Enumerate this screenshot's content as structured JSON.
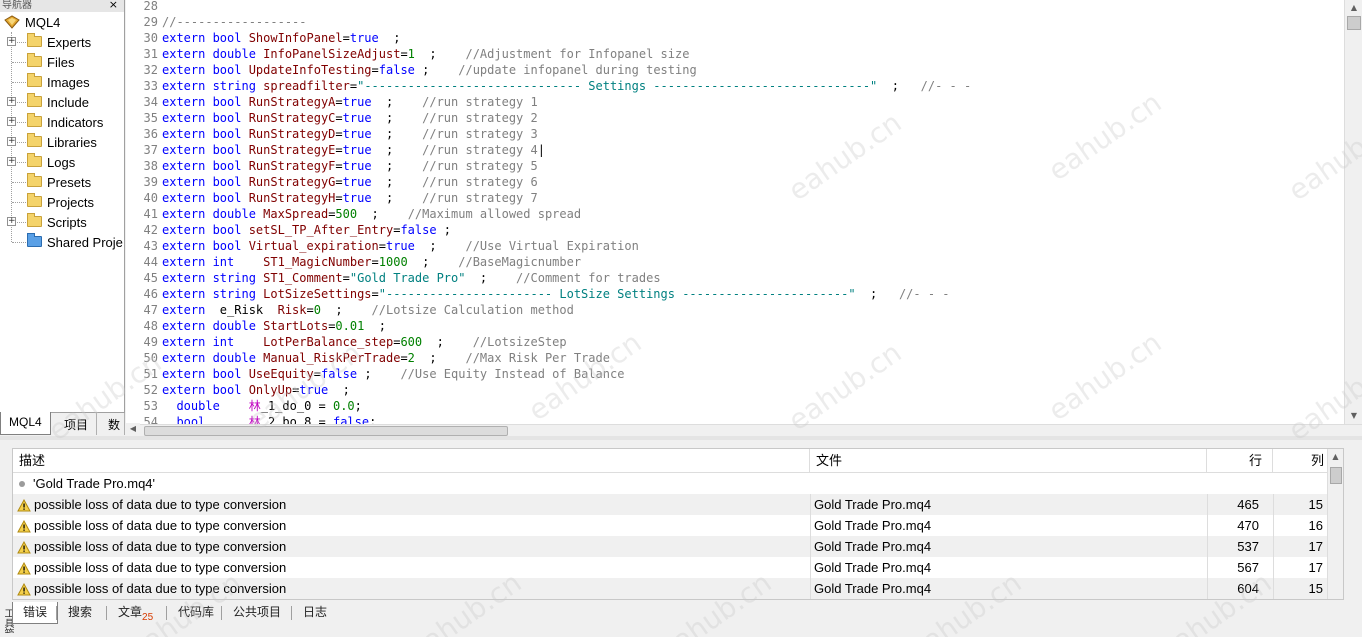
{
  "navigator": {
    "title": "导航器",
    "close_label": "×",
    "root_label": "MQL4",
    "items": [
      {
        "label": "Experts",
        "expandable": true
      },
      {
        "label": "Files",
        "expandable": false
      },
      {
        "label": "Images",
        "expandable": false
      },
      {
        "label": "Include",
        "expandable": true
      },
      {
        "label": "Indicators",
        "expandable": true
      },
      {
        "label": "Libraries",
        "expandable": true
      },
      {
        "label": "Logs",
        "expandable": true
      },
      {
        "label": "Presets",
        "expandable": false
      },
      {
        "label": "Projects",
        "expandable": false
      },
      {
        "label": "Scripts",
        "expandable": true
      },
      {
        "label": "Shared Proje",
        "expandable": false,
        "icon": "blue"
      }
    ],
    "tabs": [
      {
        "label": "MQL4",
        "active": true
      },
      {
        "label": "项目",
        "active": false
      },
      {
        "label": "数",
        "active": false
      }
    ]
  },
  "editor": {
    "lines": [
      {
        "n": "28",
        "t": []
      },
      {
        "n": "29",
        "t": [
          [
            "c",
            "//------------------"
          ]
        ]
      },
      {
        "n": "30",
        "t": [
          [
            "k",
            "extern "
          ],
          [
            "t",
            "bool "
          ],
          [
            "i",
            "ShowInfoPanel"
          ],
          [
            "p",
            "="
          ],
          [
            "k",
            "true"
          ],
          [
            "p",
            "  ;"
          ]
        ]
      },
      {
        "n": "31",
        "t": [
          [
            "k",
            "extern "
          ],
          [
            "t",
            "double "
          ],
          [
            "i",
            "InfoPanelSizeAdjust"
          ],
          [
            "p",
            "="
          ],
          [
            "n",
            "1"
          ],
          [
            "p",
            "  ;    "
          ],
          [
            "c",
            "//Adjustment for Infopanel size"
          ]
        ]
      },
      {
        "n": "32",
        "t": [
          [
            "k",
            "extern "
          ],
          [
            "t",
            "bool "
          ],
          [
            "i",
            "UpdateInfoTesting"
          ],
          [
            "p",
            "="
          ],
          [
            "k",
            "false"
          ],
          [
            "p",
            " ;    "
          ],
          [
            "c",
            "//update infopanel during testing"
          ]
        ]
      },
      {
        "n": "33",
        "t": [
          [
            "k",
            "extern "
          ],
          [
            "t",
            "string "
          ],
          [
            "i",
            "spreadfilter"
          ],
          [
            "p",
            "="
          ],
          [
            "s",
            "\"------------------------------ Settings ------------------------------\""
          ],
          [
            "p",
            "  ;   "
          ],
          [
            "c",
            "//- - -"
          ]
        ]
      },
      {
        "n": "34",
        "t": [
          [
            "k",
            "extern "
          ],
          [
            "t",
            "bool "
          ],
          [
            "i",
            "RunStrategyA"
          ],
          [
            "p",
            "="
          ],
          [
            "k",
            "true"
          ],
          [
            "p",
            "  ;    "
          ],
          [
            "c",
            "//run strategy 1"
          ]
        ]
      },
      {
        "n": "35",
        "t": [
          [
            "k",
            "extern "
          ],
          [
            "t",
            "bool "
          ],
          [
            "i",
            "RunStrategyC"
          ],
          [
            "p",
            "="
          ],
          [
            "k",
            "true"
          ],
          [
            "p",
            "  ;    "
          ],
          [
            "c",
            "//run strategy 2"
          ]
        ]
      },
      {
        "n": "36",
        "t": [
          [
            "k",
            "extern "
          ],
          [
            "t",
            "bool "
          ],
          [
            "i",
            "RunStrategyD"
          ],
          [
            "p",
            "="
          ],
          [
            "k",
            "true"
          ],
          [
            "p",
            "  ;    "
          ],
          [
            "c",
            "//run strategy 3"
          ]
        ]
      },
      {
        "n": "37",
        "t": [
          [
            "k",
            "extern "
          ],
          [
            "t",
            "bool "
          ],
          [
            "i",
            "RunStrategyE"
          ],
          [
            "p",
            "="
          ],
          [
            "k",
            "true"
          ],
          [
            "p",
            "  ;    "
          ],
          [
            "c",
            "//run strategy 4"
          ],
          [
            "x",
            "|"
          ]
        ]
      },
      {
        "n": "38",
        "t": [
          [
            "k",
            "extern "
          ],
          [
            "t",
            "bool "
          ],
          [
            "i",
            "RunStrategyF"
          ],
          [
            "p",
            "="
          ],
          [
            "k",
            "true"
          ],
          [
            "p",
            "  ;    "
          ],
          [
            "c",
            "//run strategy 5"
          ]
        ]
      },
      {
        "n": "39",
        "t": [
          [
            "k",
            "extern "
          ],
          [
            "t",
            "bool "
          ],
          [
            "i",
            "RunStrategyG"
          ],
          [
            "p",
            "="
          ],
          [
            "k",
            "true"
          ],
          [
            "p",
            "  ;    "
          ],
          [
            "c",
            "//run strategy 6"
          ]
        ]
      },
      {
        "n": "40",
        "t": [
          [
            "k",
            "extern "
          ],
          [
            "t",
            "bool "
          ],
          [
            "i",
            "RunStrategyH"
          ],
          [
            "p",
            "="
          ],
          [
            "k",
            "true"
          ],
          [
            "p",
            "  ;    "
          ],
          [
            "c",
            "//run strategy 7"
          ]
        ]
      },
      {
        "n": "41",
        "t": [
          [
            "k",
            "extern "
          ],
          [
            "t",
            "double "
          ],
          [
            "i",
            "MaxSpread"
          ],
          [
            "p",
            "="
          ],
          [
            "n",
            "500"
          ],
          [
            "p",
            "  ;    "
          ],
          [
            "c",
            "//Maximum allowed spread"
          ]
        ]
      },
      {
        "n": "42",
        "t": [
          [
            "k",
            "extern "
          ],
          [
            "t",
            "bool "
          ],
          [
            "i",
            "setSL_TP_After_Entry"
          ],
          [
            "p",
            "="
          ],
          [
            "k",
            "false"
          ],
          [
            "p",
            " ;"
          ]
        ]
      },
      {
        "n": "43",
        "t": [
          [
            "k",
            "extern "
          ],
          [
            "t",
            "bool "
          ],
          [
            "i",
            "Virtual_expiration"
          ],
          [
            "p",
            "="
          ],
          [
            "k",
            "true"
          ],
          [
            "p",
            "  ;    "
          ],
          [
            "c",
            "//Use Virtual Expiration"
          ]
        ]
      },
      {
        "n": "44",
        "t": [
          [
            "k",
            "extern "
          ],
          [
            "t",
            "int    "
          ],
          [
            "i",
            "ST1_MagicNumber"
          ],
          [
            "p",
            "="
          ],
          [
            "n",
            "1000"
          ],
          [
            "p",
            "  ;    "
          ],
          [
            "c",
            "//BaseMagicnumber"
          ]
        ]
      },
      {
        "n": "45",
        "t": [
          [
            "k",
            "extern "
          ],
          [
            "t",
            "string "
          ],
          [
            "i",
            "ST1_Comment"
          ],
          [
            "p",
            "="
          ],
          [
            "s",
            "\"Gold Trade Pro\""
          ],
          [
            "p",
            "  ;    "
          ],
          [
            "c",
            "//Comment for trades"
          ]
        ]
      },
      {
        "n": "46",
        "t": [
          [
            "k",
            "extern "
          ],
          [
            "t",
            "string "
          ],
          [
            "i",
            "LotSizeSettings"
          ],
          [
            "p",
            "="
          ],
          [
            "s",
            "\"----------------------- LotSize Settings -----------------------\""
          ],
          [
            "p",
            "  ;   "
          ],
          [
            "c",
            "//- - -"
          ]
        ]
      },
      {
        "n": "47",
        "t": [
          [
            "k",
            "extern  "
          ],
          [
            "p",
            "e_Risk  "
          ],
          [
            "i",
            "Risk"
          ],
          [
            "p",
            "="
          ],
          [
            "n",
            "0"
          ],
          [
            "p",
            "  ;    "
          ],
          [
            "c",
            "//Lotsize Calculation method"
          ]
        ]
      },
      {
        "n": "48",
        "t": [
          [
            "k",
            "extern "
          ],
          [
            "t",
            "double "
          ],
          [
            "i",
            "StartLots"
          ],
          [
            "p",
            "="
          ],
          [
            "n",
            "0.01"
          ],
          [
            "p",
            "  ;"
          ]
        ]
      },
      {
        "n": "49",
        "t": [
          [
            "k",
            "extern "
          ],
          [
            "t",
            "int    "
          ],
          [
            "i",
            "LotPerBalance_step"
          ],
          [
            "p",
            "="
          ],
          [
            "n",
            "600"
          ],
          [
            "p",
            "  ;    "
          ],
          [
            "c",
            "//LotsizeStep"
          ]
        ]
      },
      {
        "n": "50",
        "t": [
          [
            "k",
            "extern "
          ],
          [
            "t",
            "double "
          ],
          [
            "i",
            "Manual_RiskPerTrade"
          ],
          [
            "p",
            "="
          ],
          [
            "n",
            "2"
          ],
          [
            "p",
            "  ;    "
          ],
          [
            "c",
            "//Max Risk Per Trade"
          ]
        ]
      },
      {
        "n": "51",
        "t": [
          [
            "k",
            "extern "
          ],
          [
            "t",
            "bool "
          ],
          [
            "i",
            "UseEquity"
          ],
          [
            "p",
            "="
          ],
          [
            "k",
            "false"
          ],
          [
            "p",
            " ;    "
          ],
          [
            "c",
            "//Use Equity Instead of Balance"
          ]
        ]
      },
      {
        "n": "52",
        "t": [
          [
            "k",
            "extern "
          ],
          [
            "t",
            "bool "
          ],
          [
            "i",
            "OnlyUp"
          ],
          [
            "p",
            "="
          ],
          [
            "k",
            "true"
          ],
          [
            "p",
            "  ;"
          ]
        ]
      },
      {
        "n": "53",
        "t": [
          [
            "p",
            "  "
          ],
          [
            "t",
            "double    "
          ],
          [
            "i",
            "林"
          ],
          [
            "p",
            "_1_do_0 = "
          ],
          [
            "n",
            "0.0"
          ],
          [
            "p",
            ";"
          ]
        ]
      },
      {
        "n": "54",
        "t": [
          [
            "p",
            "  "
          ],
          [
            "t",
            "bool      "
          ],
          [
            "i",
            "林"
          ],
          [
            "p",
            "_2_bo_8 = "
          ],
          [
            "k",
            "false"
          ],
          [
            "p",
            ";"
          ]
        ]
      }
    ]
  },
  "errors": {
    "headers": {
      "desc": "描述",
      "file": "文件",
      "row": "行",
      "col": "列"
    },
    "title_row": "'Gold Trade Pro.mq4'",
    "rows": [
      {
        "desc": "possible loss of data due to type conversion",
        "file": "Gold Trade Pro.mq4",
        "row": "465",
        "col": "15"
      },
      {
        "desc": "possible loss of data due to type conversion",
        "file": "Gold Trade Pro.mq4",
        "row": "470",
        "col": "16"
      },
      {
        "desc": "possible loss of data due to type conversion",
        "file": "Gold Trade Pro.mq4",
        "row": "537",
        "col": "17"
      },
      {
        "desc": "possible loss of data due to type conversion",
        "file": "Gold Trade Pro.mq4",
        "row": "567",
        "col": "17"
      },
      {
        "desc": "possible loss of data due to type conversion",
        "file": "Gold Trade Pro.mq4",
        "row": "604",
        "col": "15"
      }
    ]
  },
  "toolbox": {
    "side_label": "工具箱",
    "tabs": [
      {
        "label": "错误",
        "active": true
      },
      {
        "label": "搜索"
      },
      {
        "label": "文章",
        "badge": "25"
      },
      {
        "label": "代码库"
      },
      {
        "label": "公共项目"
      },
      {
        "label": "日志"
      }
    ]
  },
  "watermark": "eahub.cn",
  "colors": {
    "keyword": "#0000ff",
    "identifier": "#800000",
    "number": "#008000",
    "string": "#008080",
    "comment": "#808080"
  }
}
